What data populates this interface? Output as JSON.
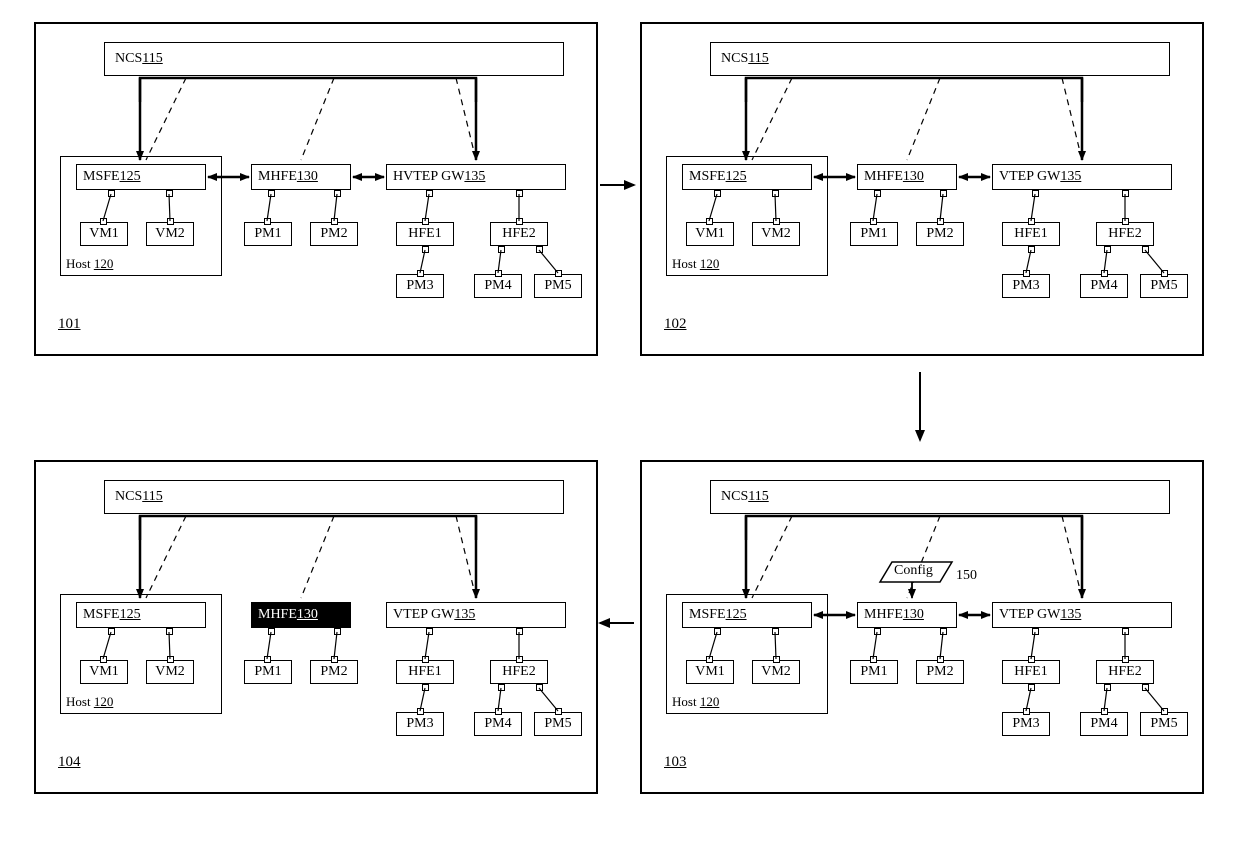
{
  "common": {
    "ncs": {
      "prefix": "NCS ",
      "id": "115"
    },
    "msfe": {
      "prefix": "MSFE ",
      "id": "125"
    },
    "mhfe": {
      "prefix": "MHFE ",
      "id": "130"
    },
    "gw_hvtep": {
      "prefix": "HVTEP GW ",
      "id": "135"
    },
    "gw_vtep": {
      "prefix": "VTEP GW ",
      "id": "135"
    },
    "host": {
      "prefix": "Host ",
      "id": "120"
    },
    "vm1": "VM1",
    "vm2": "VM2",
    "pm1": "PM1",
    "pm2": "PM2",
    "hfe1": "HFE1",
    "hfe2": "HFE2",
    "pm3": "PM3",
    "pm4": "PM4",
    "pm5": "PM5",
    "config": "Config",
    "config_id": "150"
  },
  "panels": {
    "p101": {
      "gw": "gw_hvtep",
      "mhfe_inverted": false,
      "show_config": false,
      "msfe_arrow": true,
      "ref": "101"
    },
    "p102": {
      "gw": "gw_vtep",
      "mhfe_inverted": false,
      "show_config": false,
      "msfe_arrow": true,
      "ref": "102"
    },
    "p103": {
      "gw": "gw_vtep",
      "mhfe_inverted": false,
      "show_config": true,
      "msfe_arrow": true,
      "ref": "103"
    },
    "p104": {
      "gw": "gw_vtep",
      "mhfe_inverted": true,
      "show_config": false,
      "msfe_arrow": false,
      "ref": "104"
    }
  }
}
